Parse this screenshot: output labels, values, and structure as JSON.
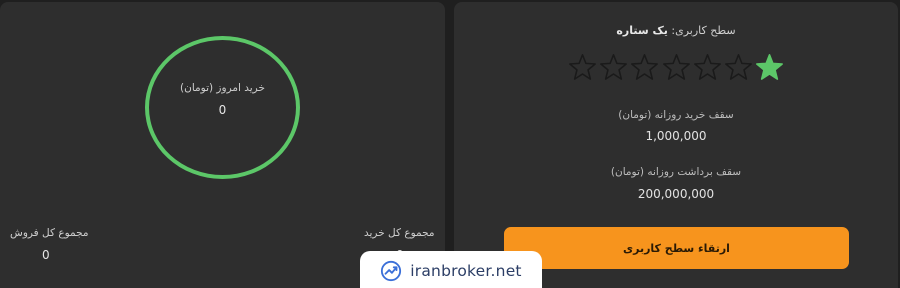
{
  "account_level": {
    "label": "سطح کاربری:",
    "value": "یک ستاره",
    "rating": {
      "filled": 1,
      "total": 7
    }
  },
  "limits": {
    "daily_buy_label": "سقف خرید روزانه (تومان)",
    "daily_buy_value": "1,000,000",
    "daily_withdraw_label": "سقف برداشت روزانه (تومان)",
    "daily_withdraw_value": "200,000,000"
  },
  "upgrade_button": {
    "label": "ارتقاء سطح کاربری"
  },
  "today_purchase": {
    "label": "خرید امروز (تومان)",
    "value": "0"
  },
  "totals": {
    "sell_label": "مجموع کل فروش",
    "sell_value": "0",
    "buy_label": "مجموع کل خرید",
    "buy_value": "0"
  },
  "watermark": {
    "text": "iranbroker.net"
  },
  "colors": {
    "accent_orange": "#f7941d",
    "accent_green": "#5cc768",
    "card_bg": "#2e2e2e",
    "page_bg": "#1f1f1f"
  }
}
